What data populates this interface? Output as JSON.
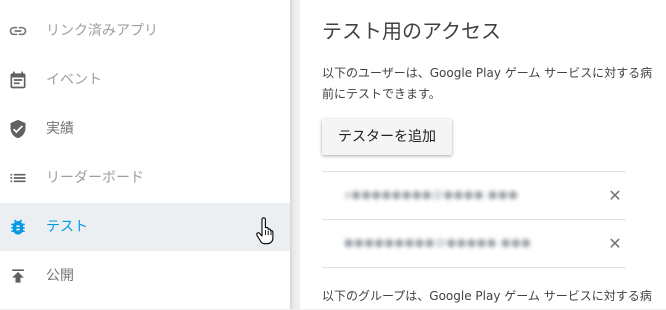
{
  "sidebar": {
    "items": [
      {
        "label": "リンク済みアプリ",
        "icon": "link-icon"
      },
      {
        "label": "イベント",
        "icon": "calendar-icon"
      },
      {
        "label": "実績",
        "icon": "shield-check-icon"
      },
      {
        "label": "リーダーボード",
        "icon": "list-icon"
      },
      {
        "label": "テスト",
        "icon": "bug-icon"
      },
      {
        "label": "公開",
        "icon": "publish-icon"
      }
    ]
  },
  "testing": {
    "title": "テスト用のアクセス",
    "description_users": "以下のユーザーは、Google Play ゲーム サービスに対する病前にテストできます。",
    "description_users_line1": "以下のユーザーは、Google Play ゲーム サービスに対する病",
    "description_users_line2": "前にテストできます。",
    "add_tester_label": "テスターを追加",
    "testers": [
      {
        "email": "a●●●●●●●●@●●●●.●●●",
        "remove_icon": "close-icon"
      },
      {
        "email": "●●●●●●●●●@●●●●●.●●●",
        "remove_icon": "close-icon"
      }
    ],
    "description_groups": "以下のグループは、Google Play ゲーム サービスに対する病"
  },
  "colors": {
    "accent": "#039be5",
    "sidebar_active_bg": "#eceff1",
    "icon_gray": "#616161"
  }
}
